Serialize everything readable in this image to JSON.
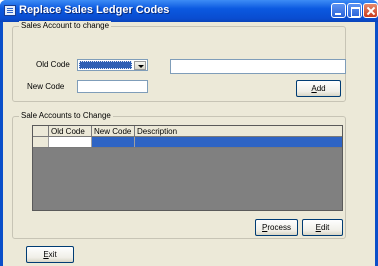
{
  "window": {
    "title": "Replace Sales Ledger Codes",
    "icon": "ledger-app-icon",
    "controls": [
      "minimize-icon",
      "maximize-icon",
      "close-icon"
    ]
  },
  "change_group": {
    "legend": "Sales Account to change",
    "old_code_label": "Old Code",
    "old_code_value": "",
    "description_value": "",
    "new_code_label": "New Code",
    "new_code_value": "",
    "add_button": {
      "underlined": "A",
      "rest": "dd"
    }
  },
  "list_group": {
    "legend": "Sale Accounts to Change",
    "columns": [
      "Old Code",
      "New Code",
      "Description"
    ],
    "rows": [
      {
        "old_code": "",
        "new_code": "",
        "description": ""
      }
    ],
    "process_button": {
      "underlined": "P",
      "rest": "rocess"
    },
    "edit_button": {
      "underlined": "E",
      "rest": "dit"
    }
  },
  "exit_button": {
    "underlined": "E",
    "rest": "xit"
  },
  "colors": {
    "titlebar": "#0b59e0",
    "dialog_bg": "#ece9d8",
    "selection": "#2e64c4",
    "grid_bg": "#808080"
  }
}
